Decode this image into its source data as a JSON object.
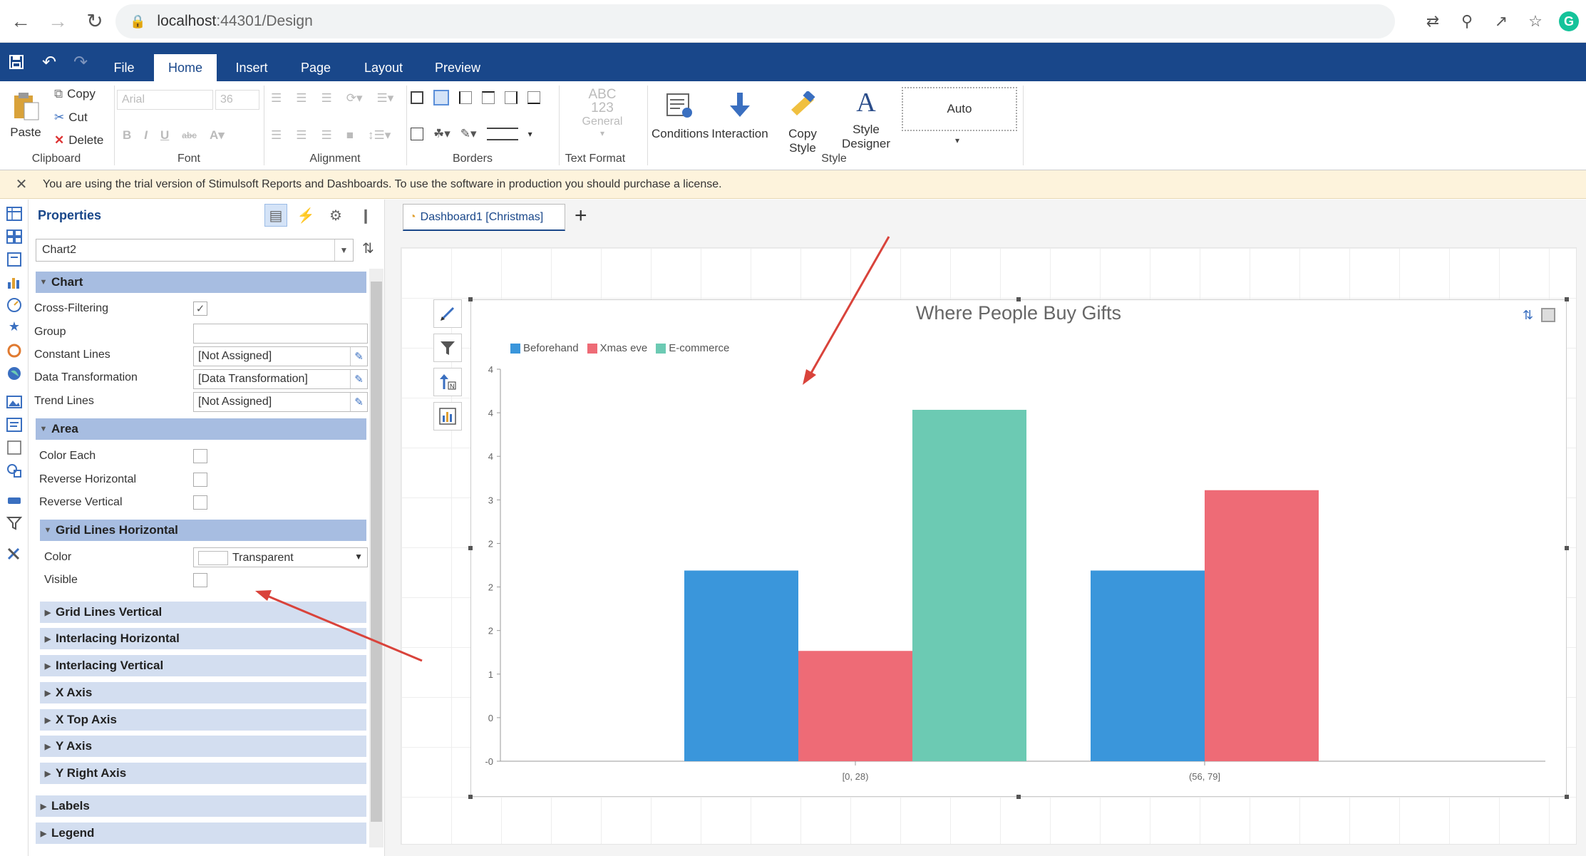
{
  "browser": {
    "url_host": "localhost",
    "url_rest": ":44301/Design"
  },
  "ribbon": {
    "tabs": [
      "File",
      "Home",
      "Insert",
      "Page",
      "Layout",
      "Preview"
    ],
    "active_tab": "Home",
    "clipboard": {
      "paste": "Paste",
      "copy": "Copy",
      "cut": "Cut",
      "delete": "Delete",
      "label": "Clipboard"
    },
    "font": {
      "family": "Arial",
      "size": "36",
      "label": "Font"
    },
    "alignment_label": "Alignment",
    "borders_label": "Borders",
    "text_format": {
      "abc": "ABC",
      "num": "123",
      "general": "General",
      "label": "Text Format"
    },
    "style": {
      "conditions": "Conditions",
      "interaction": "Interaction",
      "copy_style": "Copy Style",
      "style_designer_1": "Style",
      "style_designer_2": "Designer",
      "auto": "Auto",
      "label": "Style"
    }
  },
  "trial": {
    "message": "You are using the trial version of Stimulsoft Reports and Dashboards. To use the software in production you should purchase a license."
  },
  "properties": {
    "title": "Properties",
    "component": "Chart2",
    "chart_category": "Chart",
    "rows": {
      "cross_filtering": "Cross-Filtering",
      "group": "Group",
      "constant_lines": "Constant Lines",
      "constant_lines_val": "[Not Assigned]",
      "data_transformation": "Data Transformation",
      "data_transformation_val": "[Data Transformation]",
      "trend_lines": "Trend Lines",
      "trend_lines_val": "[Not Assigned]"
    },
    "area_category": "Area",
    "area_rows": {
      "color_each": "Color Each",
      "reverse_horizontal": "Reverse Horizontal",
      "reverse_vertical": "Reverse Vertical"
    },
    "grid_h_category": "Grid Lines Horizontal",
    "grid_h_rows": {
      "color": "Color",
      "color_val": "Transparent",
      "visible": "Visible"
    },
    "collapsed_sub": [
      "Grid Lines Vertical",
      "Interlacing Horizontal",
      "Interlacing Vertical",
      "X Axis",
      "X Top Axis",
      "Y Axis",
      "Y Right Axis"
    ],
    "collapsed_top": [
      "Labels",
      "Legend"
    ]
  },
  "doc_tab": {
    "label": "Dashboard1 [Christmas]"
  },
  "colors": {
    "brand": "#19478a",
    "beforehand": "#3a96db",
    "xmas_eve": "#ee6b76",
    "ecommerce": "#6ccab3"
  },
  "chart_data": {
    "type": "bar",
    "title": "Where People Buy Gifts",
    "categories": [
      "[0, 28)",
      "(56, 79]"
    ],
    "series": [
      {
        "name": "Beforehand",
        "values": [
          2,
          2
        ]
      },
      {
        "name": "Xmas eve",
        "values": [
          1,
          3
        ]
      },
      {
        "name": "E-commerce",
        "values": [
          4,
          0
        ]
      }
    ],
    "ytick_labels": [
      "-0",
      "0",
      "1",
      "2",
      "2",
      "2",
      "3",
      "4",
      "4",
      "4"
    ],
    "ylim": [
      0,
      4
    ],
    "grid": false,
    "legend_position": "top-left"
  }
}
